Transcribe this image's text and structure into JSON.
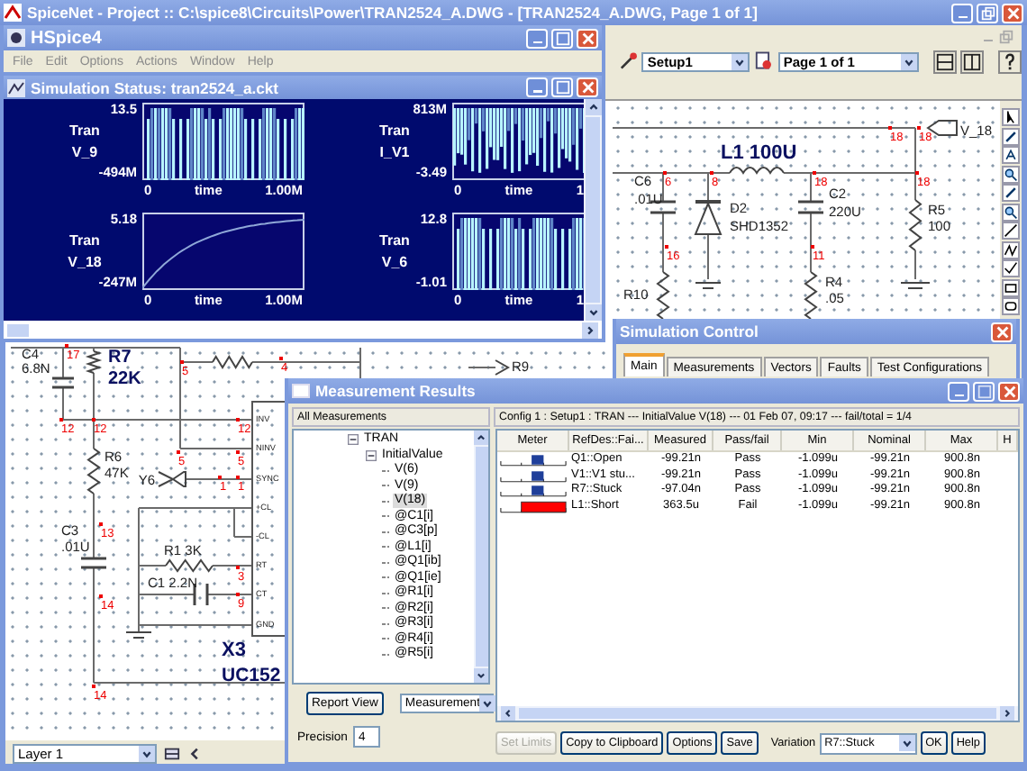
{
  "main_window": {
    "title": "SpiceNet - Project :: C:\\spice8\\Circuits\\Power\\TRAN2524_A.DWG - [TRAN2524_A.DWG, Page 1 of 1]",
    "toolbar": {
      "setup": "Setup1",
      "page": "Page 1 of 1"
    },
    "layer": "Layer 1"
  },
  "schematic": {
    "labels": [
      "L1 100U",
      "C6",
      ".01U",
      "D2",
      "SHD1352",
      "C2",
      "220U",
      "R5",
      "100",
      "R4",
      ".05",
      "R10",
      "C4",
      "6.8N",
      "R7",
      "22K",
      "R6",
      "47K",
      "C3",
      ".01U",
      "R1 3K",
      "C1 2.2N",
      "X3",
      "UC152",
      "R9"
    ],
    "pins": [
      "INV",
      "NINV",
      "SYNC",
      "+CL",
      "-CL",
      "RT",
      "CT",
      "GND"
    ],
    "ports": [
      "V_18",
      "Y6"
    ],
    "nodes": [
      "18",
      "18",
      "6",
      "8",
      "18",
      "18",
      "16",
      "11",
      "17",
      "12",
      "12",
      "12",
      "5",
      "5",
      "1",
      "1",
      "13",
      "3",
      "9",
      "14",
      "14",
      "5",
      "4"
    ]
  },
  "hspice": {
    "title": "HSpice4",
    "menu": [
      "File",
      "Edit",
      "Options",
      "Actions",
      "Window",
      "Help"
    ],
    "status_title": "Simulation Status: tran2524_a.ckt",
    "plots": [
      {
        "analysis": "Tran",
        "signal": "V_9",
        "y_max": "13.5",
        "y_min": "-494M",
        "x_min": "0",
        "x_label": "time",
        "x_max": "1.00M",
        "kind": "bars"
      },
      {
        "analysis": "Tran",
        "signal": "I_V1",
        "y_max": "813M",
        "y_min": "-3.49",
        "x_min": "0",
        "x_label": "time",
        "x_max": "1",
        "kind": "spikes"
      },
      {
        "analysis": "Tran",
        "signal": "V_18",
        "y_max": "5.18",
        "y_min": "-247M",
        "x_min": "0",
        "x_label": "time",
        "x_max": "1.00M",
        "kind": "curve"
      },
      {
        "analysis": "Tran",
        "signal": "V_6",
        "y_max": "12.8",
        "y_min": "-1.01",
        "x_min": "0",
        "x_label": "time",
        "x_max": "1",
        "kind": "bars"
      }
    ]
  },
  "simulation_control": {
    "title": "Simulation Control",
    "tabs": [
      {
        "label": "Main",
        "selected": true
      },
      {
        "label": "Measurements",
        "selected": false
      },
      {
        "label": "Vectors",
        "selected": false
      },
      {
        "label": "Faults",
        "selected": false
      },
      {
        "label": "Test Configurations",
        "selected": false
      }
    ]
  },
  "measurement_results": {
    "title": "Measurement Results",
    "tree_header": "All Measurements",
    "summary": "Config 1 : Setup1 : TRAN --- InitialValue V(18) --- 01 Feb 07, 09:17 --- fail/total = 1/4",
    "tree": [
      {
        "label": "TRAN",
        "expanded": true,
        "selected": false,
        "children": [
          {
            "label": "InitialValue",
            "expanded": true,
            "selected": false,
            "children": [
              {
                "label": "V(6)",
                "selected": false
              },
              {
                "label": "V(9)",
                "selected": false
              },
              {
                "label": "V(18)",
                "selected": true
              },
              {
                "label": "@C1[i]",
                "selected": false
              },
              {
                "label": "@C3[p]",
                "selected": false
              },
              {
                "label": "@L1[i]",
                "selected": false
              },
              {
                "label": "@Q1[ib]",
                "selected": false
              },
              {
                "label": "@Q1[ie]",
                "selected": false
              },
              {
                "label": "@R1[i]",
                "selected": false
              },
              {
                "label": "@R2[i]",
                "selected": false
              },
              {
                "label": "@R3[i]",
                "selected": false
              },
              {
                "label": "@R4[i]",
                "selected": false
              },
              {
                "label": "@R5[i]",
                "selected": false
              }
            ]
          }
        ]
      }
    ],
    "view_button": "Report View",
    "view_select": "Measurement",
    "precision": {
      "label": "Precision",
      "value": "4"
    },
    "columns": [
      "Meter",
      "RefDes::Fai...",
      "Measured",
      "Pass/fail",
      "Min",
      "Nominal",
      "Max",
      "H"
    ],
    "rows": [
      {
        "failed": false,
        "refdes": "Q1::Open",
        "measured": "-99.21n",
        "pass_fail": "Pass",
        "min": "-1.099u",
        "nominal": "-99.21n",
        "max": "900.8n"
      },
      {
        "failed": false,
        "refdes": "V1::V1 stu...",
        "measured": "-99.21n",
        "pass_fail": "Pass",
        "min": "-1.099u",
        "nominal": "-99.21n",
        "max": "900.8n"
      },
      {
        "failed": false,
        "refdes": "R7::Stuck",
        "measured": "-97.04n",
        "pass_fail": "Pass",
        "min": "-1.099u",
        "nominal": "-99.21n",
        "max": "900.8n"
      },
      {
        "failed": true,
        "refdes": "L1::Short",
        "measured": "363.5u",
        "pass_fail": "Fail",
        "min": "-1.099u",
        "nominal": "-99.21n",
        "max": "900.8n"
      }
    ],
    "actions": [
      {
        "label": "Set Limits",
        "disabled": true
      },
      {
        "label": "Copy to Clipboard",
        "disabled": false
      },
      {
        "label": "Options",
        "disabled": false
      },
      {
        "label": "Save",
        "disabled": false
      }
    ],
    "variation": {
      "label": "Variation",
      "value": "R7::Stuck"
    },
    "dialog_buttons": [
      {
        "label": "OK",
        "disabled": false
      },
      {
        "label": "Help",
        "disabled": false
      }
    ]
  }
}
